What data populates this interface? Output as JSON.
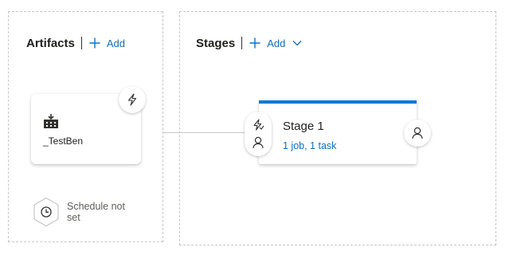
{
  "artifacts": {
    "title": "Artifacts",
    "add_label": "Add",
    "items": [
      {
        "name": "_TestBen",
        "icon": "build-pipeline-icon"
      }
    ],
    "schedule_label": "Schedule not set"
  },
  "stages": {
    "title": "Stages",
    "add_label": "Add",
    "items": [
      {
        "name": "Stage 1",
        "summary": "1 job, 1 task"
      }
    ]
  },
  "colors": {
    "accent": "#0078d4",
    "link": "#106ebe",
    "border_dashed": "#c8c6c4"
  }
}
